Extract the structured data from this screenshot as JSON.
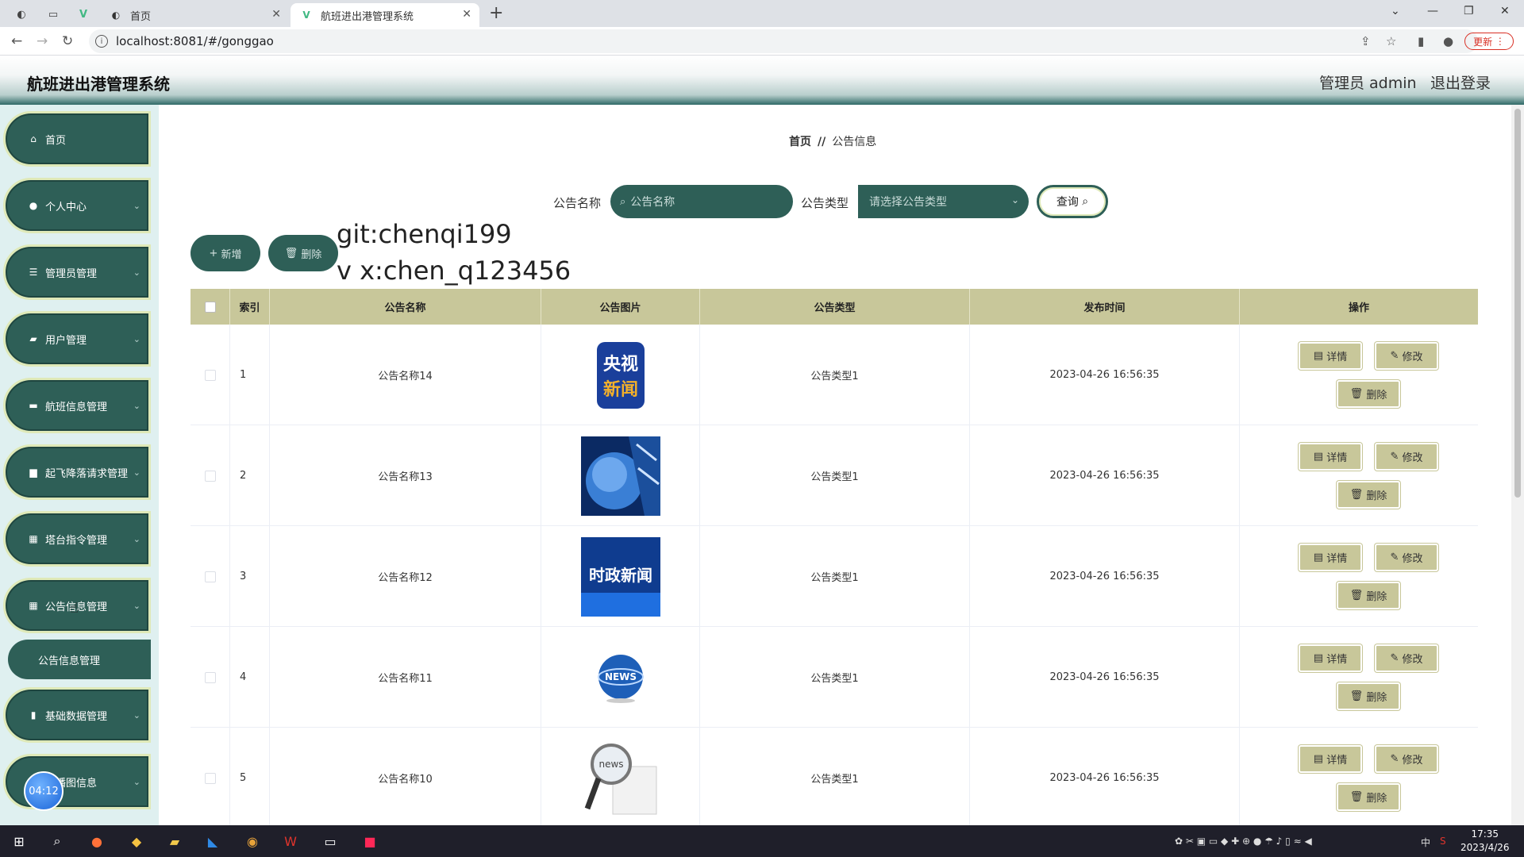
{
  "browser": {
    "tabs": [
      {
        "title": "首页"
      },
      {
        "title": "航班进出港管理系统"
      }
    ],
    "url": "localhost:8081/#/gonggao",
    "update_label": "更新"
  },
  "header": {
    "title": "航班进出港管理系统",
    "admin": "管理员 admin",
    "logout": "退出登录"
  },
  "sidebar": {
    "items": [
      {
        "label": "首页"
      },
      {
        "label": "个人中心"
      },
      {
        "label": "管理员管理"
      },
      {
        "label": "用户管理"
      },
      {
        "label": "航班信息管理"
      },
      {
        "label": "起飞降落请求管理"
      },
      {
        "label": "塔台指令管理"
      },
      {
        "label": "公告信息管理"
      },
      {
        "label": "基础数据管理"
      },
      {
        "label": "轮播图信息"
      }
    ],
    "sub_item": "公告信息管理",
    "timer": "04:12"
  },
  "breadcrumb": {
    "home": "首页",
    "sep": "//",
    "current": "公告信息"
  },
  "search": {
    "name_label": "公告名称",
    "name_placeholder": "公告名称",
    "type_label": "公告类型",
    "type_placeholder": "请选择公告类型",
    "query_label": "查询"
  },
  "toolbar": {
    "add_label": "新增",
    "delete_label": "删除"
  },
  "watermark": {
    "line1": "git:chenqi199",
    "line2": "v x:chen_q123456"
  },
  "table": {
    "headers": [
      "索引",
      "公告名称",
      "公告图片",
      "公告类型",
      "发布时间",
      "操作"
    ],
    "rows": [
      {
        "index": "1",
        "name": "公告名称14",
        "type": "公告类型1",
        "time": "2023-04-26 16:56:35",
        "img_text": "央视新闻"
      },
      {
        "index": "2",
        "name": "公告名称13",
        "type": "公告类型1",
        "time": "2023-04-26 16:56:35",
        "img_text": ""
      },
      {
        "index": "3",
        "name": "公告名称12",
        "type": "公告类型1",
        "time": "2023-04-26 16:56:35",
        "img_text": "时政新闻"
      },
      {
        "index": "4",
        "name": "公告名称11",
        "type": "公告类型1",
        "time": "2023-04-26 16:56:35",
        "img_text": "NEWS"
      },
      {
        "index": "5",
        "name": "公告名称10",
        "type": "公告类型1",
        "time": "2023-04-26 16:56:35",
        "img_text": "news"
      }
    ],
    "actions": {
      "detail": "详情",
      "edit": "修改",
      "delete": "删除"
    }
  },
  "taskbar": {
    "time": "17:35",
    "date": "2023/4/26",
    "ime": "中"
  },
  "colors": {
    "primary": "#2e5f57",
    "accent": "#c8c79a"
  }
}
